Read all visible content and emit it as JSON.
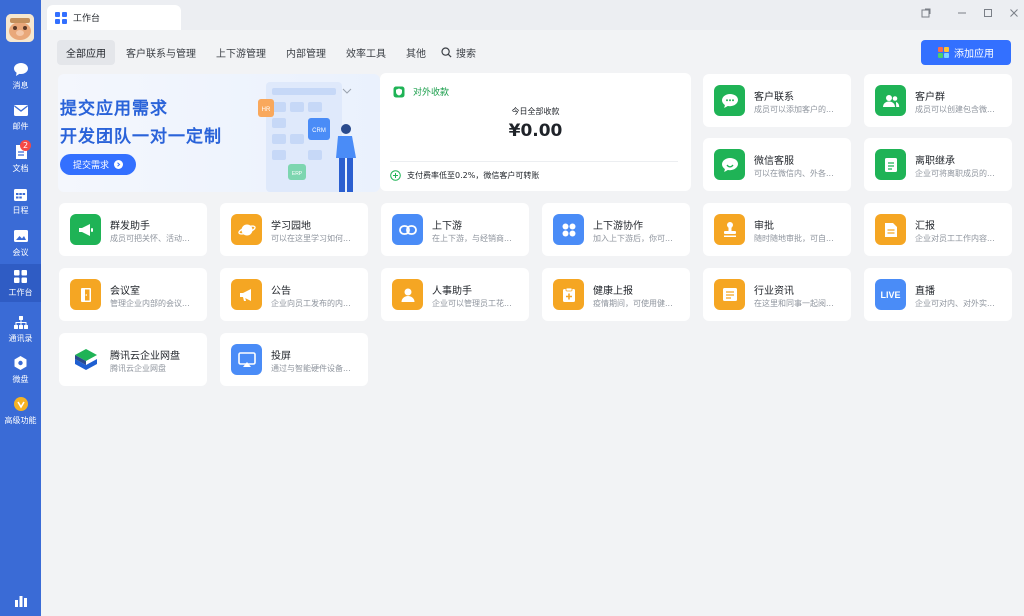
{
  "sidebar": {
    "items": [
      {
        "label": "消息",
        "icon": "chat-icon"
      },
      {
        "label": "邮件",
        "icon": "mail-icon"
      },
      {
        "label": "文档",
        "icon": "document-icon",
        "badge": "2"
      },
      {
        "label": "日程",
        "icon": "calendar-icon"
      },
      {
        "label": "会议",
        "icon": "meeting-icon"
      },
      {
        "label": "工作台",
        "icon": "workbench-icon"
      },
      {
        "label": "通讯录",
        "icon": "contacts-icon"
      },
      {
        "label": "微盘",
        "icon": "drive-icon"
      },
      {
        "label": "高级功能",
        "icon": "premium-icon"
      }
    ],
    "bottom_icon": "stats-icon"
  },
  "window": {
    "tab_title": "工作台"
  },
  "filters": {
    "tabs": [
      "全部应用",
      "客户联系与管理",
      "上下游管理",
      "内部管理",
      "效率工具",
      "其他"
    ],
    "search_label": "搜索"
  },
  "toolbar": {
    "add_app_label": "添加应用"
  },
  "banner": {
    "line1": "提交应用需求",
    "line2": "开发团队一对一定制",
    "button_label": "提交需求",
    "tags": [
      "HR",
      "CRM",
      "ERP"
    ]
  },
  "payment": {
    "title": "对外收款",
    "subtitle": "今日全部收款",
    "amount": "¥0.00",
    "footer": "支付费率低至0.2%，微信客户可转账"
  },
  "apps": [
    {
      "name": "客户联系",
      "desc": "成员可以添加客户的...",
      "color": "#1fb356",
      "icon": "chat-bubble-icon"
    },
    {
      "name": "客户群",
      "desc": "成员可以创建包含微...",
      "color": "#1fb356",
      "icon": "group-icon"
    },
    {
      "name": "微信客服",
      "desc": "可以在微信内、外各...",
      "color": "#1fb356",
      "icon": "service-chat-icon"
    },
    {
      "name": "离职继承",
      "desc": "企业可将离职成员的...",
      "color": "#1fb356",
      "icon": "transfer-list-icon"
    },
    {
      "name": "群发助手",
      "desc": "成员可把关怀、活动...",
      "color": "#1fb356",
      "icon": "megaphone-icon"
    },
    {
      "name": "学习园地",
      "desc": "可以在这里学习如何...",
      "color": "#f5a623",
      "icon": "planet-icon"
    },
    {
      "name": "上下游",
      "desc": "在上下游，与经销商...",
      "color": "#4a8cf7",
      "icon": "link-icon"
    },
    {
      "name": "上下游协作",
      "desc": "加入上下游后，你可...",
      "color": "#4a8cf7",
      "icon": "grid-apps-icon"
    },
    {
      "name": "审批",
      "desc": "随时随地审批，可自...",
      "color": "#f5a623",
      "icon": "stamp-icon"
    },
    {
      "name": "汇报",
      "desc": "企业对员工工作内容...",
      "color": "#f5a623",
      "icon": "report-icon"
    },
    {
      "name": "会议室",
      "desc": "管理企业内部的会议...",
      "color": "#f5a623",
      "icon": "door-icon"
    },
    {
      "name": "公告",
      "desc": "企业向员工发布的内...",
      "color": "#f5a623",
      "icon": "announcement-icon"
    },
    {
      "name": "人事助手",
      "desc": "企业可以管理员工花...",
      "color": "#f5a623",
      "icon": "person-icon"
    },
    {
      "name": "健康上报",
      "desc": "疫情期间，可使用健...",
      "color": "#f5a623",
      "icon": "health-icon"
    },
    {
      "name": "行业资讯",
      "desc": "在这里和同事一起阅...",
      "color": "#f5a623",
      "icon": "news-icon"
    },
    {
      "name": "直播",
      "desc": "企业可对内、对外实...",
      "color": "#4a8cf7",
      "icon": "live-icon",
      "icon_text": "LIVE"
    },
    {
      "name": "腾讯云企业网盘",
      "desc": "腾讯云企业网盘",
      "color": "#ffffff",
      "icon": "cloud-drive-icon"
    },
    {
      "name": "投屏",
      "desc": "通过与智能硬件设备...",
      "color": "#4a8cf7",
      "icon": "screen-cast-icon"
    }
  ]
}
